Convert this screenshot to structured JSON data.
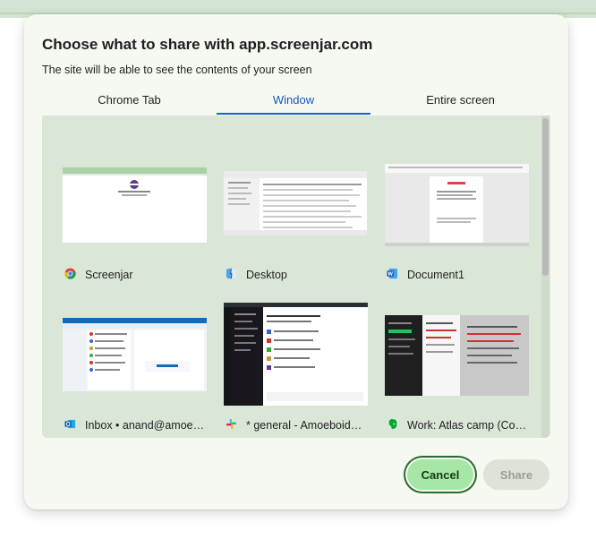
{
  "dialog": {
    "title": "Choose what to share with app.screenjar.com",
    "subtitle": "The site will be able to see the contents of your screen"
  },
  "tabs": {
    "chrome_tab": "Chrome Tab",
    "window": "Window",
    "entire_screen": "Entire screen",
    "selected": "window"
  },
  "sources": [
    {
      "label": "Screenjar",
      "icon": "chrome-icon"
    },
    {
      "label": "Desktop",
      "icon": "finder-icon"
    },
    {
      "label": "Document1",
      "icon": "word-icon"
    },
    {
      "label": "Inbox • anand@amoe…",
      "icon": "outlook-icon"
    },
    {
      "label": "* general - Amoeboid…",
      "icon": "slack-icon"
    },
    {
      "label": "Work: Atlas camp (Co…",
      "icon": "evernote-icon"
    }
  ],
  "buttons": {
    "cancel": "Cancel",
    "share": "Share"
  },
  "colors": {
    "accent": "#1a5fc8",
    "dialog_bg": "#f6f9f1",
    "panel_bg": "#dbe7d6",
    "cancel_bg": "#a6e6a6"
  }
}
